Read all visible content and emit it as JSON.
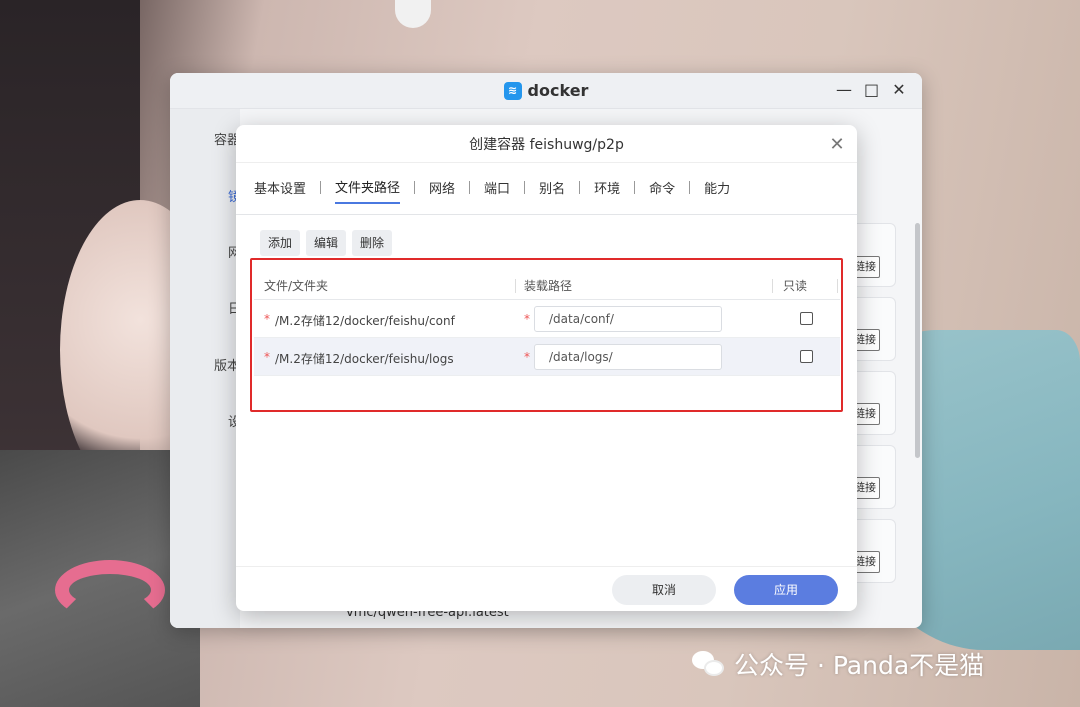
{
  "app": {
    "title": "docker",
    "logo_icon": "docker-whale-icon"
  },
  "window_controls": {
    "minimize": "—",
    "maximize": "□",
    "close": "✕"
  },
  "sidebar": {
    "items": [
      {
        "label": "容器"
      },
      {
        "label": "镜"
      },
      {
        "label": "网"
      },
      {
        "label": "日"
      },
      {
        "label": "版本"
      },
      {
        "label": "设"
      }
    ]
  },
  "right_list": {
    "button_label": "链接",
    "bottom_text": "vmc/qwen-free-api:latest"
  },
  "dialog": {
    "title": "创建容器 feishuwg/p2p",
    "tabs": [
      {
        "label": "基本设置"
      },
      {
        "label": "文件夹路径",
        "active": true
      },
      {
        "label": "网络"
      },
      {
        "label": "端口"
      },
      {
        "label": "别名"
      },
      {
        "label": "环境"
      },
      {
        "label": "命令"
      },
      {
        "label": "能力"
      }
    ],
    "toolbar": {
      "add": "添加",
      "edit": "编辑",
      "delete": "删除"
    },
    "table": {
      "headers": {
        "folder": "文件/文件夹",
        "mount_path": "装载路径",
        "readonly": "只读"
      },
      "required_mark": "*",
      "rows": [
        {
          "folder": "/M.2存储12/docker/feishu/conf",
          "mount_path": "/data/conf/",
          "readonly": false
        },
        {
          "folder": "/M.2存储12/docker/feishu/logs",
          "mount_path": "/data/logs/",
          "readonly": false
        }
      ]
    },
    "footer": {
      "cancel": "取消",
      "apply": "应用"
    }
  },
  "watermark": {
    "text": "公众号 · Panda不是猫"
  },
  "colors": {
    "accent": "#5b7de0",
    "highlight": "#e02a2a",
    "docker_blue": "#2496ed"
  }
}
